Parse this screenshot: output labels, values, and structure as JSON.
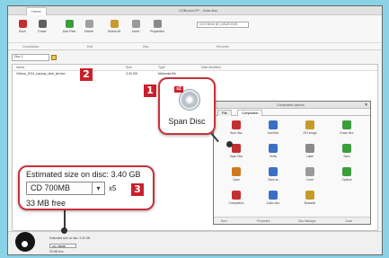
{
  "window": {
    "title": "CDBurnerXP - Data disc",
    "tab_home": "Home"
  },
  "ribbon": {
    "buttons": [
      {
        "label": "Burn",
        "color": "#c43030"
      },
      {
        "label": "Erase",
        "color": "#606060"
      },
      {
        "label": "Add Files",
        "color": "#3b9e3b"
      },
      {
        "label": "Delete",
        "color": "#a0a0a0"
      },
      {
        "label": "Select All",
        "color": "#c79a2a"
      },
      {
        "label": "Invert",
        "color": "#9a9a9a"
      },
      {
        "label": "Properties",
        "color": "#8a8a8a"
      }
    ],
    "drive_combo": "0:0:0 Drive (E:) ASUS DVD",
    "groups": [
      "Compilation",
      "Edit",
      "Disc",
      "Recorder"
    ]
  },
  "toolbar": {
    "disc_label": "Disc 1"
  },
  "filelist": {
    "headers": [
      "Name",
      "Size",
      "Type",
      "Date Modified"
    ],
    "rows": [
      {
        "name": "Videos_2014_backup_disk_all.mkv",
        "size": "3.40 GB",
        "type": "Matroska file",
        "date": ""
      }
    ]
  },
  "statusbar": {
    "line1": "Estimated size on disc: 3.40 GB",
    "combo": "CD 700MB",
    "line2": "33 MB free"
  },
  "dialog": {
    "title": "Compilation options",
    "close": "×",
    "tabs": [
      "File",
      "Compilation"
    ],
    "tiles": [
      {
        "label": "Burn disc",
        "color": "#c43030"
      },
      {
        "label": "Add files",
        "color": "#3b6fc4"
      },
      {
        "label": "ISO image",
        "color": "#c79a2a"
      },
      {
        "label": "Erase disc",
        "color": "#3b9e3b"
      },
      {
        "label": "Span Disc",
        "color": "#c43030"
      },
      {
        "label": "Verify",
        "color": "#3b6fc4"
      },
      {
        "label": "Label",
        "color": "#8a8a8a"
      },
      {
        "label": "Save",
        "color": "#3b9e3b"
      },
      {
        "label": "Open",
        "color": "#d07a20"
      },
      {
        "label": "Save as",
        "color": "#3b6fc4"
      },
      {
        "label": "Cover",
        "color": "#9a9a9a"
      },
      {
        "label": "Options",
        "color": "#3b9e3b"
      },
      {
        "label": "Compilation",
        "color": "#c43030"
      },
      {
        "label": "Audio disc",
        "color": "#3b6fc4"
      },
      {
        "label": "Bootable",
        "color": "#c79a2a"
      }
    ],
    "footer": [
      "Burn",
      "Properties",
      "Disc Manager",
      "Close"
    ]
  },
  "callout_span": {
    "label": "Span Disc",
    "icon_badge": "x2"
  },
  "callout_size": {
    "estimate": "Estimated size on disc: 3.40 GB",
    "select_value": "CD 700MB",
    "select_arrow": "▾",
    "multiplier": "x5",
    "free": "33 MB free"
  },
  "badges": [
    "1",
    "2",
    "3"
  ],
  "colors": {
    "accent": "#c8212c",
    "background": "#8ad2e6"
  }
}
